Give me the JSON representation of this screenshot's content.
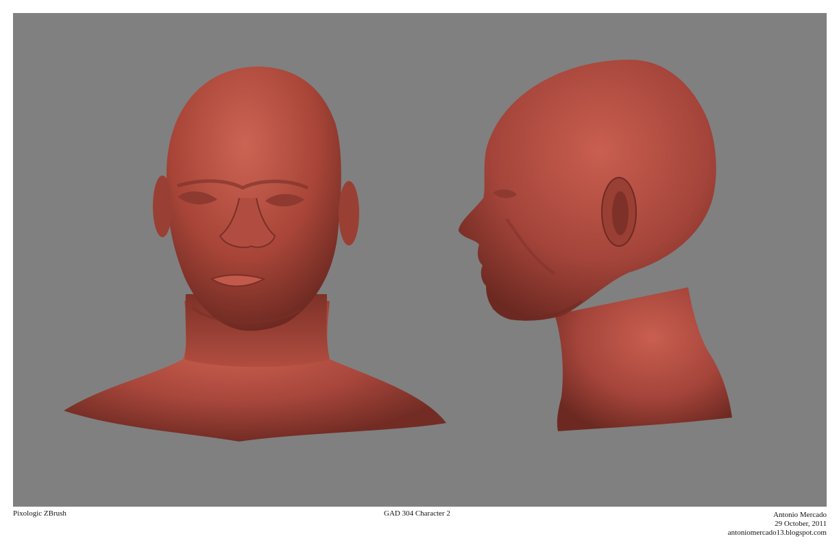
{
  "footer": {
    "software": "Pixologic ZBrush",
    "project": "GAD 304 Character 2",
    "author": "Antonio Mercado",
    "date": "29 October, 2011",
    "website": "antoniomercado13.blogspot.com"
  },
  "colors": {
    "viewport_background": "#808080",
    "clay_base": "#a9473c",
    "clay_highlight": "#c65d4f",
    "clay_shadow": "#6e2a22",
    "page_background": "#ffffff"
  },
  "views": {
    "front": "front-view",
    "side": "side-view"
  }
}
